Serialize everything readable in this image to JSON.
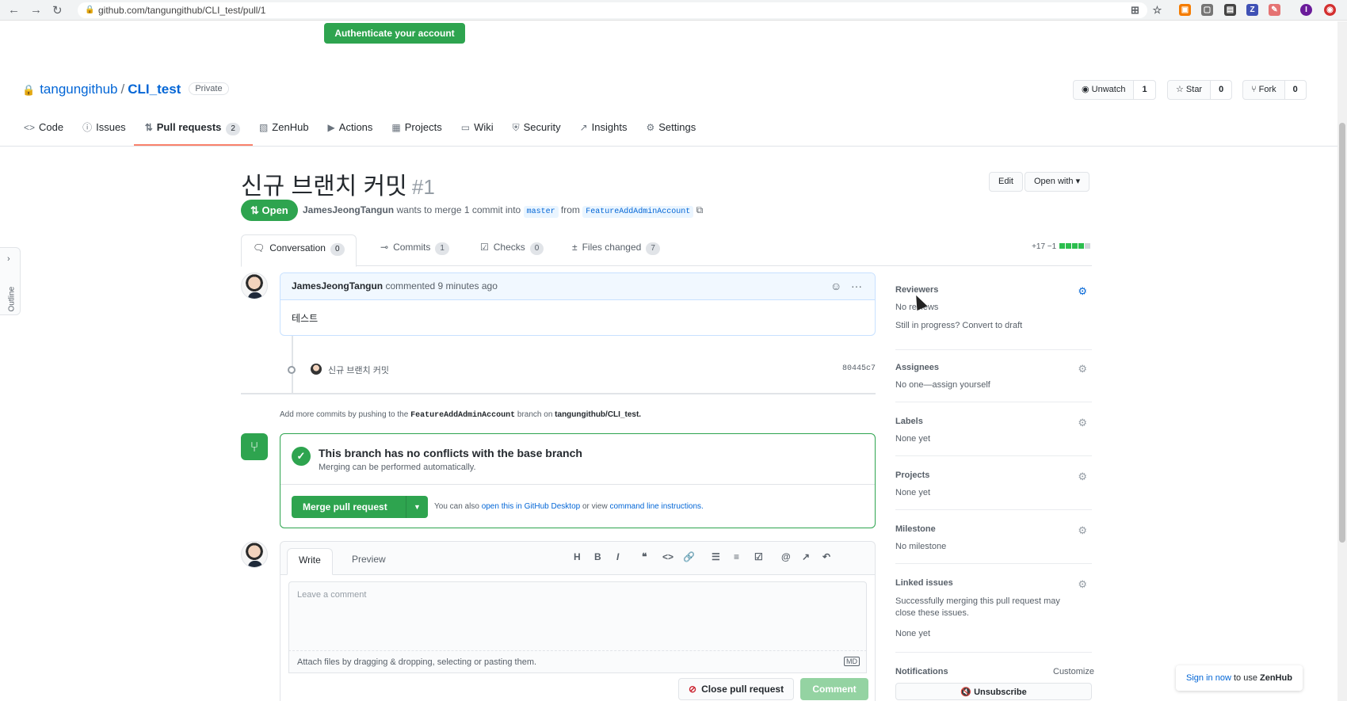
{
  "browser": {
    "url": "github.com/tangungithub/CLI_test/pull/1",
    "extensions": [
      {
        "name": "translate-icon",
        "color": "#5f6368",
        "glyph": "⊞"
      },
      {
        "name": "star-icon",
        "color": "#5f6368",
        "glyph": "☆"
      },
      {
        "name": "ext-orange-icon",
        "color": "#f57c00",
        "glyph": "▣"
      },
      {
        "name": "ext-gray-icon",
        "color": "#757575",
        "glyph": "▢"
      },
      {
        "name": "ext-dark-icon",
        "color": "#444444",
        "glyph": "▤"
      },
      {
        "name": "zenhub-icon",
        "color": "#3f51b5",
        "glyph": "Z"
      },
      {
        "name": "ext-red-icon",
        "color": "#e57373",
        "glyph": "✎"
      },
      {
        "name": "profile-icon",
        "color": "#6a1b9a",
        "glyph": "I"
      },
      {
        "name": "ext-redcircle-icon",
        "color": "#d32f2f",
        "glyph": "◉"
      }
    ]
  },
  "banner": {
    "auth_button": "Authenticate your account"
  },
  "repo": {
    "owner": "tangungithub",
    "separator": "/",
    "name": "CLI_test",
    "visibility": "Private",
    "unwatch_label": "Unwatch",
    "unwatch_count": "1",
    "star_label": "Star",
    "star_count": "0",
    "fork_label": "Fork",
    "fork_count": "0"
  },
  "repo_tabs": [
    {
      "label": "Code",
      "icon": "<>",
      "counter": ""
    },
    {
      "label": "Issues",
      "icon": "ⓘ",
      "counter": ""
    },
    {
      "label": "Pull requests",
      "icon": "⇅",
      "counter": "2"
    },
    {
      "label": "ZenHub",
      "icon": "▧",
      "counter": ""
    },
    {
      "label": "Actions",
      "icon": "▶",
      "counter": ""
    },
    {
      "label": "Projects",
      "icon": "▦",
      "counter": ""
    },
    {
      "label": "Wiki",
      "icon": "▭",
      "counter": ""
    },
    {
      "label": "Security",
      "icon": "⛨",
      "counter": ""
    },
    {
      "label": "Insights",
      "icon": "↗",
      "counter": ""
    },
    {
      "label": "Settings",
      "icon": "⚙",
      "counter": ""
    }
  ],
  "outline_tab": {
    "label": "Outline"
  },
  "pr": {
    "title": "신규 브랜치 커밋",
    "number": "#1",
    "edit_label": "Edit",
    "open_with_label": "Open with",
    "state": "Open",
    "author": "JamesJeongTangun",
    "merge_text_1": "wants to merge 1 commit into",
    "base_branch": "master",
    "merge_text_2": "from",
    "head_branch": "FeatureAddAdminAccount"
  },
  "pr_tabs": [
    {
      "label": "Conversation",
      "icon": "🗨",
      "counter": "0"
    },
    {
      "label": "Commits",
      "icon": "⊸",
      "counter": "1"
    },
    {
      "label": "Checks",
      "icon": "☑",
      "counter": "0"
    },
    {
      "label": "Files changed",
      "icon": "±",
      "counter": "7"
    }
  ],
  "diffstat": {
    "text": "+17 −1"
  },
  "comment": {
    "author": "JamesJeongTangun",
    "meta": "commented 9 minutes ago",
    "body": "테스트"
  },
  "commit": {
    "message": "신규 브랜치 커밋",
    "sha": "80445c7"
  },
  "push_hint": {
    "pre": "Add more commits by pushing to the",
    "branch": "FeatureAddAdminAccount",
    "mid": "branch on",
    "repo": "tangungithub/CLI_test."
  },
  "merge": {
    "title": "This branch has no conflicts with the base branch",
    "subtitle": "Merging can be performed automatically.",
    "button": "Merge pull request",
    "note_pre": "You can also",
    "note_link1": "open this in GitHub Desktop",
    "note_mid": "or view",
    "note_link2": "command line instructions."
  },
  "write": {
    "tab_write": "Write",
    "tab_preview": "Preview",
    "toolbar": [
      "H",
      "B",
      "I",
      "❝",
      "<>",
      "🔗",
      "☰",
      "≡",
      "☑",
      "@",
      "↗",
      "↶"
    ],
    "placeholder": "Leave a comment",
    "attach_text": "Attach files by dragging & dropping, selecting or pasting them.",
    "markdown_badge": "MD",
    "close_label": "Close pull request",
    "comment_label": "Comment"
  },
  "sidebar": {
    "reviewers_title": "Reviewers",
    "reviewers_value": "No reviews",
    "reviewers_draft": "Still in progress? Convert to draft",
    "assignees_title": "Assignees",
    "assignees_value": "No one—assign yourself",
    "labels_title": "Labels",
    "labels_value": "None yet",
    "projects_title": "Projects",
    "projects_value": "None yet",
    "milestone_title": "Milestone",
    "milestone_value": "No milestone",
    "linked_title": "Linked issues",
    "linked_desc": "Successfully merging this pull request may close these issues.",
    "linked_value": "None yet",
    "notifications_title": "Notifications",
    "notifications_customize": "Customize",
    "unsubscribe_label": "Unsubscribe"
  },
  "zenhub_popup": {
    "link": "Sign in now",
    "rest": "to use",
    "brand": "ZenHub"
  }
}
